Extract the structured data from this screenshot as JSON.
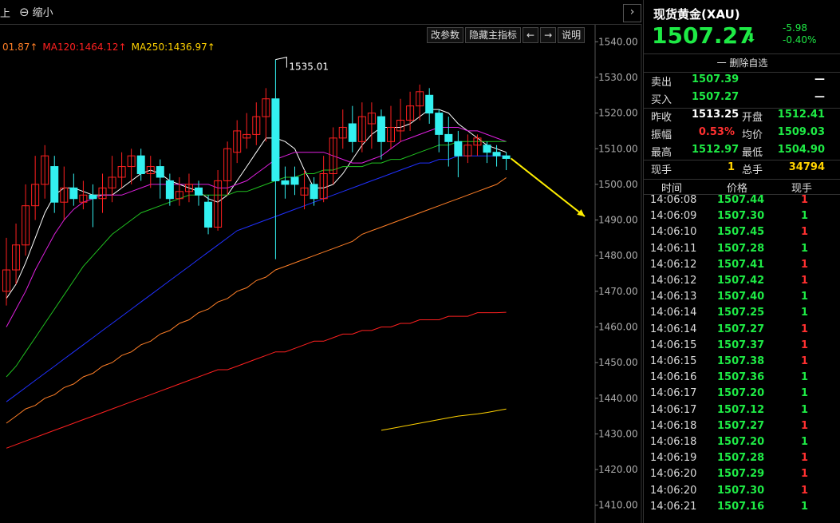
{
  "topbar": {
    "edge_label": "上",
    "zoom_label": "缩小",
    "collapse_glyph": "›"
  },
  "toolbar": {
    "buttons": [
      "改参数",
      "隐藏主指标",
      "←",
      "→",
      "说明"
    ]
  },
  "ma_legend": [
    {
      "text": "01.87↑",
      "color": "#ff7f27"
    },
    {
      "text": "MA120:1464.12↑",
      "color": "#ff2020"
    },
    {
      "text": "MA250:1436.97↑",
      "color": "#ffd200"
    }
  ],
  "chart_data": {
    "type": "candlestick",
    "y_axis": {
      "min": 1405,
      "max": 1545,
      "ticks": [
        1540,
        1530,
        1520,
        1510,
        1500,
        1490,
        1480,
        1470,
        1460,
        1450,
        1440,
        1430,
        1420,
        1410
      ]
    },
    "annotation": {
      "label": "1535.01",
      "value": 1535.01
    },
    "up_color": "#ff2020",
    "down_color": "#33f0f0",
    "candles": [
      {
        "o": 1470,
        "c": 1476,
        "h": 1485,
        "l": 1466
      },
      {
        "o": 1476,
        "c": 1483,
        "h": 1489,
        "l": 1472
      },
      {
        "o": 1483,
        "c": 1494,
        "h": 1500,
        "l": 1480
      },
      {
        "o": 1494,
        "c": 1500,
        "h": 1508,
        "l": 1490
      },
      {
        "o": 1500,
        "c": 1508,
        "h": 1511,
        "l": 1496
      },
      {
        "o": 1505,
        "c": 1495,
        "h": 1508,
        "l": 1492
      },
      {
        "o": 1495,
        "c": 1499,
        "h": 1505,
        "l": 1490
      },
      {
        "o": 1499,
        "c": 1496,
        "h": 1503,
        "l": 1494
      },
      {
        "o": 1495,
        "c": 1497,
        "h": 1501,
        "l": 1493
      },
      {
        "o": 1497,
        "c": 1496,
        "h": 1500,
        "l": 1488
      },
      {
        "o": 1496,
        "c": 1499,
        "h": 1503,
        "l": 1492
      },
      {
        "o": 1499,
        "c": 1502,
        "h": 1508,
        "l": 1495
      },
      {
        "o": 1502,
        "c": 1505,
        "h": 1509,
        "l": 1499
      },
      {
        "o": 1505,
        "c": 1508,
        "h": 1510,
        "l": 1500
      },
      {
        "o": 1508,
        "c": 1503,
        "h": 1510,
        "l": 1501
      },
      {
        "o": 1503,
        "c": 1505,
        "h": 1508,
        "l": 1499
      },
      {
        "o": 1505,
        "c": 1502,
        "h": 1507,
        "l": 1496
      },
      {
        "o": 1501,
        "c": 1496,
        "h": 1503,
        "l": 1494
      },
      {
        "o": 1496,
        "c": 1498,
        "h": 1502,
        "l": 1494
      },
      {
        "o": 1498,
        "c": 1500,
        "h": 1503,
        "l": 1495
      },
      {
        "o": 1499,
        "c": 1497,
        "h": 1501,
        "l": 1494
      },
      {
        "o": 1495,
        "c": 1488,
        "h": 1497,
        "l": 1486
      },
      {
        "o": 1488,
        "c": 1501,
        "h": 1504,
        "l": 1487
      },
      {
        "o": 1501,
        "c": 1510,
        "h": 1512,
        "l": 1497
      },
      {
        "o": 1509,
        "c": 1515,
        "h": 1518,
        "l": 1506
      },
      {
        "o": 1513,
        "c": 1514,
        "h": 1520,
        "l": 1510
      },
      {
        "o": 1514,
        "c": 1519,
        "h": 1523,
        "l": 1511
      },
      {
        "o": 1519,
        "c": 1524,
        "h": 1527,
        "l": 1512
      },
      {
        "o": 1524,
        "c": 1501,
        "h": 1535,
        "l": 1479
      },
      {
        "o": 1501,
        "c": 1500,
        "h": 1505,
        "l": 1496
      },
      {
        "o": 1502,
        "c": 1500,
        "h": 1505,
        "l": 1497
      },
      {
        "o": 1497,
        "c": 1499,
        "h": 1504,
        "l": 1493
      },
      {
        "o": 1500,
        "c": 1496,
        "h": 1502,
        "l": 1494
      },
      {
        "o": 1496,
        "c": 1503,
        "h": 1508,
        "l": 1495
      },
      {
        "o": 1503,
        "c": 1513,
        "h": 1516,
        "l": 1500
      },
      {
        "o": 1513,
        "c": 1516,
        "h": 1521,
        "l": 1510
      },
      {
        "o": 1517,
        "c": 1512,
        "h": 1522,
        "l": 1509
      },
      {
        "o": 1512,
        "c": 1519,
        "h": 1523,
        "l": 1509
      },
      {
        "o": 1517,
        "c": 1520,
        "h": 1523,
        "l": 1510
      },
      {
        "o": 1519,
        "c": 1512,
        "h": 1521,
        "l": 1507
      },
      {
        "o": 1512,
        "c": 1516,
        "h": 1522,
        "l": 1510
      },
      {
        "o": 1515,
        "c": 1518,
        "h": 1524,
        "l": 1512
      },
      {
        "o": 1518,
        "c": 1522,
        "h": 1526,
        "l": 1515
      },
      {
        "o": 1522,
        "c": 1526,
        "h": 1528,
        "l": 1518
      },
      {
        "o": 1525,
        "c": 1520,
        "h": 1527,
        "l": 1517
      },
      {
        "o": 1520,
        "c": 1514,
        "h": 1521,
        "l": 1509
      },
      {
        "o": 1514,
        "c": 1512,
        "h": 1519,
        "l": 1505
      },
      {
        "o": 1512,
        "c": 1508,
        "h": 1515,
        "l": 1502
      },
      {
        "o": 1508,
        "c": 1511,
        "h": 1514,
        "l": 1506
      },
      {
        "o": 1511,
        "c": 1513,
        "h": 1514,
        "l": 1508
      },
      {
        "o": 1511,
        "c": 1509,
        "h": 1512,
        "l": 1506
      },
      {
        "o": 1509,
        "c": 1508,
        "h": 1511,
        "l": 1505
      },
      {
        "o": 1508,
        "c": 1507.27,
        "h": 1509,
        "l": 1504
      }
    ],
    "ma_lines": [
      {
        "name": "MA5",
        "color": "#ffffff",
        "values": [
          1468,
          1472,
          1478,
          1485,
          1492,
          1497,
          1499,
          1499,
          1498,
          1497,
          1497,
          1497,
          1499,
          1501,
          1503,
          1504,
          1503,
          1501,
          1500,
          1499,
          1498,
          1496,
          1495,
          1497,
          1501,
          1505,
          1509,
          1513,
          1513,
          1512,
          1510,
          1504,
          1499,
          1499,
          1500,
          1503,
          1507,
          1511,
          1514,
          1516,
          1516,
          1516,
          1517,
          1519,
          1521,
          1521,
          1520,
          1517,
          1515,
          1513,
          1511,
          1510,
          1509
        ]
      },
      {
        "name": "MA10",
        "color": "#e020e0",
        "values": [
          1460,
          1465,
          1470,
          1476,
          1481,
          1486,
          1490,
          1493,
          1495,
          1496,
          1497,
          1497,
          1497,
          1498,
          1499,
          1500,
          1500,
          1500,
          1500,
          1500,
          1500,
          1500,
          1499,
          1499,
          1500,
          1501,
          1503,
          1505,
          1507,
          1508,
          1509,
          1509,
          1509,
          1509,
          1508,
          1507,
          1506,
          1506,
          1507,
          1508,
          1510,
          1512,
          1513,
          1514,
          1515,
          1516,
          1516,
          1516,
          1515,
          1515,
          1514,
          1513,
          1512
        ]
      },
      {
        "name": "MA20",
        "color": "#20c020",
        "values": [
          1446,
          1449,
          1453,
          1457,
          1461,
          1465,
          1469,
          1473,
          1477,
          1480,
          1483,
          1486,
          1488,
          1490,
          1492,
          1493,
          1494,
          1495,
          1496,
          1497,
          1497,
          1497,
          1497,
          1497,
          1498,
          1498,
          1499,
          1500,
          1501,
          1502,
          1502,
          1503,
          1503,
          1504,
          1504,
          1505,
          1505,
          1505,
          1506,
          1506,
          1507,
          1507,
          1508,
          1509,
          1510,
          1511,
          1511,
          1512,
          1512,
          1512,
          1512,
          1512,
          1512
        ]
      },
      {
        "name": "MA40",
        "color": "#2030ff",
        "values": [
          1439,
          1441,
          1443,
          1445,
          1447,
          1449,
          1451,
          1453,
          1455,
          1457,
          1459,
          1461,
          1463,
          1465,
          1467,
          1469,
          1471,
          1473,
          1475,
          1477,
          1479,
          1481,
          1483,
          1485,
          1487,
          1488,
          1489,
          1490,
          1491,
          1492,
          1493,
          1494,
          1495,
          1496,
          1497,
          1498,
          1499,
          1500,
          1501,
          1502,
          1503,
          1504,
          1505,
          1506,
          1506,
          1507,
          1507,
          1508,
          1508,
          1508,
          1508,
          1508,
          1508
        ]
      },
      {
        "name": "MA60",
        "color": "#ff7f27",
        "values": [
          1433,
          1435,
          1437,
          1438,
          1440,
          1441,
          1443,
          1444,
          1446,
          1447,
          1449,
          1450,
          1452,
          1453,
          1455,
          1456,
          1458,
          1459,
          1461,
          1462,
          1464,
          1465,
          1467,
          1468,
          1470,
          1471,
          1473,
          1474,
          1476,
          1477,
          1478,
          1479,
          1480,
          1481,
          1482,
          1483,
          1484,
          1486,
          1487,
          1488,
          1489,
          1490,
          1491,
          1492,
          1493,
          1494,
          1495,
          1496,
          1497,
          1498,
          1499,
          1500,
          1501.87
        ]
      },
      {
        "name": "MA120",
        "color": "#ff2020",
        "values": [
          1426,
          1427,
          1428,
          1429,
          1430,
          1431,
          1432,
          1433,
          1434,
          1435,
          1436,
          1437,
          1438,
          1439,
          1440,
          1441,
          1442,
          1443,
          1444,
          1445,
          1446,
          1447,
          1448,
          1448,
          1449,
          1450,
          1451,
          1452,
          1453,
          1453,
          1454,
          1455,
          1456,
          1456,
          1457,
          1458,
          1458,
          1459,
          1459,
          1460,
          1460,
          1461,
          1461,
          1462,
          1462,
          1462,
          1463,
          1463,
          1463,
          1464,
          1464,
          1464,
          1464.12
        ]
      },
      {
        "name": "MA250",
        "color": "#ffd200",
        "start_index": 39,
        "values": [
          1431,
          1431.5,
          1432,
          1432.5,
          1433,
          1433.5,
          1434,
          1434.5,
          1435,
          1435.3,
          1435.6,
          1436,
          1436.5,
          1436.97
        ]
      }
    ],
    "trend_arrow": {
      "from_value": 1507.27,
      "to_value": 1491
    }
  },
  "panel": {
    "title": "现货黄金(XAU)",
    "price": "1507.27",
    "arrow": "⬇",
    "change": "-5.98",
    "change_pct": "-0.40%",
    "fav_label": "一 删除自选",
    "sell_label": "卖出",
    "sell_price": "1507.39",
    "sell_qty": "—",
    "buy_label": "买入",
    "buy_price": "1507.27",
    "buy_qty": "—",
    "stats": [
      {
        "l1": "昨收",
        "v1": "1513.25",
        "c1": "white",
        "l2": "开盘",
        "v2": "1512.41",
        "c2": "green"
      },
      {
        "l1": "振幅",
        "v1": "0.53%",
        "c1": "red",
        "l2": "均价",
        "v2": "1509.03",
        "c2": "green"
      },
      {
        "l1": "最高",
        "v1": "1512.97",
        "c1": "green",
        "l2": "最低",
        "v2": "1504.90",
        "c2": "green"
      },
      {
        "l1": "现手",
        "v1": "1",
        "c1": "yellow",
        "l2": "总手",
        "v2": "34794",
        "c2": "yellow"
      }
    ],
    "tick_headers": [
      "时间",
      "价格",
      "现手"
    ],
    "ticks": [
      {
        "t": "14:06:08",
        "p": "1507.44",
        "q": "1",
        "c": "red"
      },
      {
        "t": "14:06:09",
        "p": "1507.30",
        "q": "1",
        "c": "green"
      },
      {
        "t": "14:06:10",
        "p": "1507.45",
        "q": "1",
        "c": "red"
      },
      {
        "t": "14:06:11",
        "p": "1507.28",
        "q": "1",
        "c": "green"
      },
      {
        "t": "14:06:12",
        "p": "1507.41",
        "q": "1",
        "c": "red"
      },
      {
        "t": "14:06:12",
        "p": "1507.42",
        "q": "1",
        "c": "red"
      },
      {
        "t": "14:06:13",
        "p": "1507.40",
        "q": "1",
        "c": "green"
      },
      {
        "t": "14:06:14",
        "p": "1507.25",
        "q": "1",
        "c": "green"
      },
      {
        "t": "14:06:14",
        "p": "1507.27",
        "q": "1",
        "c": "red"
      },
      {
        "t": "14:06:15",
        "p": "1507.37",
        "q": "1",
        "c": "red"
      },
      {
        "t": "14:06:15",
        "p": "1507.38",
        "q": "1",
        "c": "red"
      },
      {
        "t": "14:06:16",
        "p": "1507.36",
        "q": "1",
        "c": "green"
      },
      {
        "t": "14:06:17",
        "p": "1507.20",
        "q": "1",
        "c": "green"
      },
      {
        "t": "14:06:17",
        "p": "1507.12",
        "q": "1",
        "c": "green"
      },
      {
        "t": "14:06:18",
        "p": "1507.27",
        "q": "1",
        "c": "red"
      },
      {
        "t": "14:06:18",
        "p": "1507.20",
        "q": "1",
        "c": "green"
      },
      {
        "t": "14:06:19",
        "p": "1507.28",
        "q": "1",
        "c": "red"
      },
      {
        "t": "14:06:20",
        "p": "1507.29",
        "q": "1",
        "c": "red"
      },
      {
        "t": "14:06:20",
        "p": "1507.30",
        "q": "1",
        "c": "red"
      },
      {
        "t": "14:06:21",
        "p": "1507.16",
        "q": "1",
        "c": "green"
      }
    ]
  }
}
